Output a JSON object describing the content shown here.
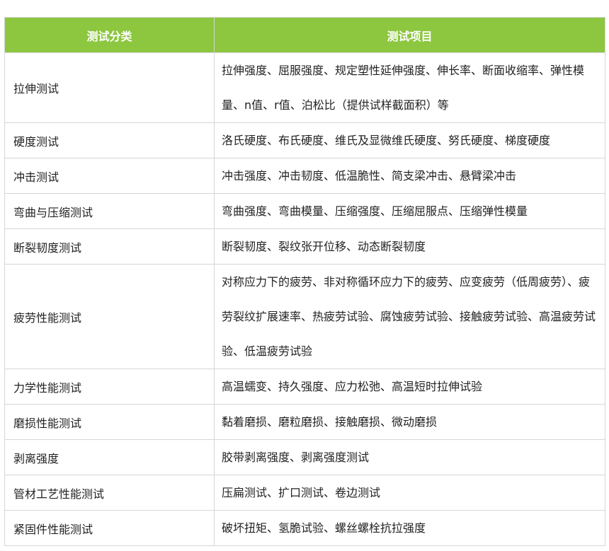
{
  "table": {
    "headers": [
      "测试分类",
      "测试项目"
    ],
    "rows": [
      {
        "category": "拉伸测试",
        "items": "拉伸强度、屈服强度、规定塑性延伸强度、伸长率、断面收缩率、弹性模量、n值、r值、泊松比（提供试样截面积）等"
      },
      {
        "category": "硬度测试",
        "items": "洛氏硬度、布氏硬度、维氏及显微维氏硬度、努氏硬度、梯度硬度"
      },
      {
        "category": "冲击测试",
        "items": "冲击强度、冲击韧度、低温脆性、简支梁冲击、悬臂梁冲击"
      },
      {
        "category": "弯曲与压缩测试",
        "items": "弯曲强度、弯曲模量、压缩强度、压缩屈服点、压缩弹性模量"
      },
      {
        "category": "断裂韧度测试",
        "items": "断裂韧度、裂纹张开位移、动态断裂韧度"
      },
      {
        "category": "疲劳性能测试",
        "items": "对称应力下的疲劳、非对称循环应力下的疲劳、应变疲劳（低周疲劳）、疲劳裂纹扩展速率、热疲劳试验、腐蚀疲劳试验、接触疲劳试验、高温疲劳试验、低温疲劳试验"
      },
      {
        "category": "力学性能测试",
        "items": "高温蠕变、持久强度、应力松弛、高温短时拉伸试验"
      },
      {
        "category": "磨损性能测试",
        "items": "黏着磨损、磨粒磨损、接触磨损、微动磨损"
      },
      {
        "category": "剥离强度",
        "items": "胶带剥离强度、剥离强度测试"
      },
      {
        "category": "管材工艺性能测试",
        "items": "压扁测试、扩口测试、卷边测试"
      },
      {
        "category": "紧固件性能测试",
        "items": "破坏扭矩、氢脆试验、螺丝螺栓抗拉强度"
      }
    ]
  },
  "colors": {
    "header_bg": "#8dc63f",
    "header_text": "#ffffff",
    "border": "#d6d6d6",
    "body_text": "#222222"
  }
}
